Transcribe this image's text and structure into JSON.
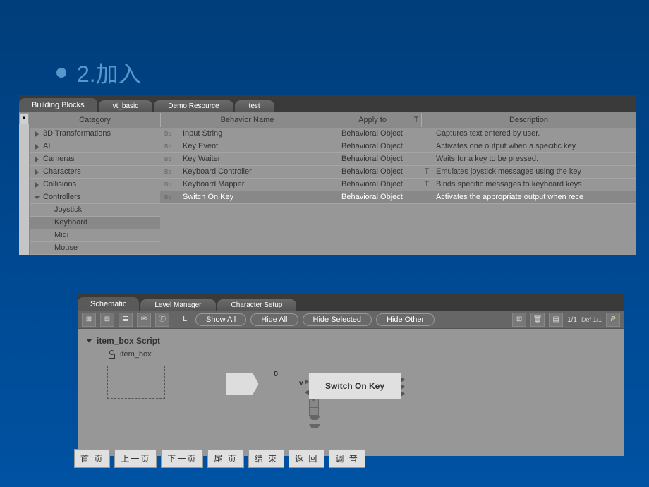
{
  "title": "2.加入",
  "bb": {
    "tabs": [
      "Building Blocks",
      "vt_basic",
      "Demo Resource",
      "test"
    ],
    "headers": {
      "category": "Category",
      "name": "Behavior Name",
      "apply": "Apply to",
      "t": "T",
      "desc": "Description"
    },
    "categories": [
      {
        "label": "3D Transformations",
        "expanded": false
      },
      {
        "label": "AI",
        "expanded": false
      },
      {
        "label": "Cameras",
        "expanded": false
      },
      {
        "label": "Characters",
        "expanded": false
      },
      {
        "label": "Collisions",
        "expanded": false
      },
      {
        "label": "Controllers",
        "expanded": true,
        "children": [
          "Joystick",
          "Keyboard",
          "Midi",
          "Mouse"
        ],
        "selected": "Keyboard"
      }
    ],
    "behaviors": [
      {
        "name": "Input String",
        "apply": "Behavioral Object",
        "t": "",
        "desc": "Captures text entered by user."
      },
      {
        "name": "Key Event",
        "apply": "Behavioral Object",
        "t": "",
        "desc": "Activates one output when a specific key"
      },
      {
        "name": "Key Waiter",
        "apply": "Behavioral Object",
        "t": "",
        "desc": "Waits for a key to be pressed."
      },
      {
        "name": "Keyboard Controller",
        "apply": "Behavioral Object",
        "t": "T",
        "desc": "Emulates joystick messages using the key"
      },
      {
        "name": "Keyboard Mapper",
        "apply": "Behavioral Object",
        "t": "T",
        "desc": "Binds specific messages to keyboard keys"
      },
      {
        "name": "Switch On Key",
        "apply": "Behavioral Object",
        "t": "",
        "desc": "Activates the appropriate output when rece",
        "selected": true
      }
    ]
  },
  "sch": {
    "tabs": [
      "Schematic",
      "Level Manager",
      "Character Setup"
    ],
    "buttons": {
      "showAll": "Show All",
      "hideAll": "Hide All",
      "hideSelected": "Hide Selected",
      "hideOther": "Hide Other"
    },
    "zoom": "1/1",
    "scope": "Def 1/1",
    "L": "L",
    "script": "item_box Script",
    "item": "item_box",
    "node": "Switch On Key",
    "link": "0",
    "v": "v"
  },
  "nav": [
    "首 页",
    "上一页",
    "下一页",
    "尾 页",
    "结 束",
    "返 回",
    "调 音"
  ]
}
